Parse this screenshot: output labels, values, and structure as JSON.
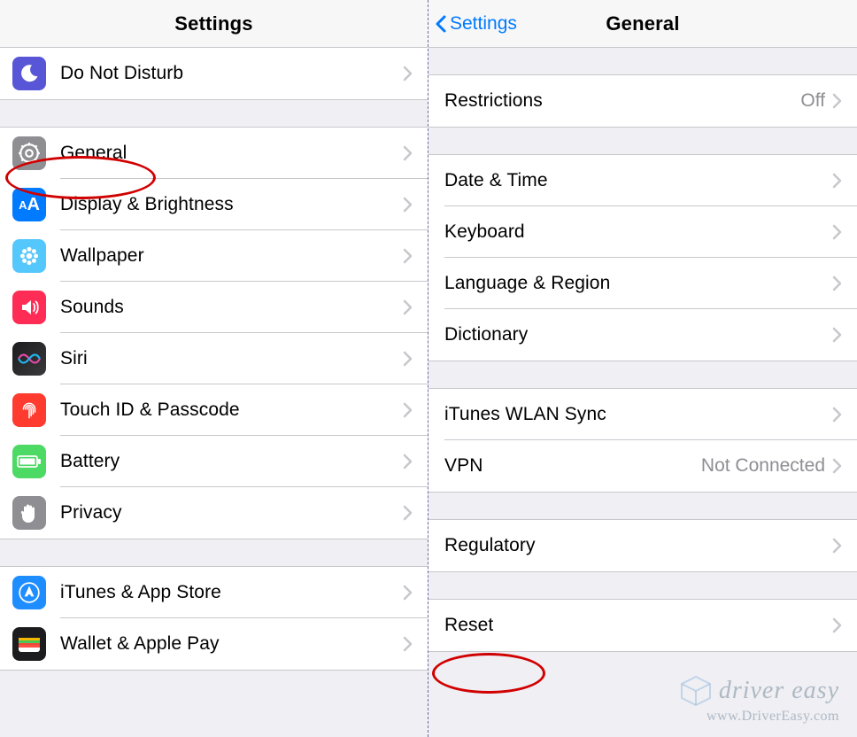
{
  "left": {
    "title": "Settings",
    "group1": [
      {
        "key": "dnd",
        "label": "Do Not Disturb"
      }
    ],
    "group2": [
      {
        "key": "general",
        "label": "General"
      },
      {
        "key": "display",
        "label": "Display & Brightness"
      },
      {
        "key": "wallpaper",
        "label": "Wallpaper"
      },
      {
        "key": "sounds",
        "label": "Sounds"
      },
      {
        "key": "siri",
        "label": "Siri"
      },
      {
        "key": "touchid",
        "label": "Touch ID & Passcode"
      },
      {
        "key": "battery",
        "label": "Battery"
      },
      {
        "key": "privacy",
        "label": "Privacy"
      }
    ],
    "group3": [
      {
        "key": "itunes",
        "label": "iTunes & App Store"
      },
      {
        "key": "wallet",
        "label": "Wallet & Apple Pay"
      }
    ]
  },
  "right": {
    "back": "Settings",
    "title": "General",
    "group1": [
      {
        "key": "restrictions",
        "label": "Restrictions",
        "value": "Off"
      }
    ],
    "group2": [
      {
        "key": "datetime",
        "label": "Date & Time"
      },
      {
        "key": "keyboard",
        "label": "Keyboard"
      },
      {
        "key": "langregion",
        "label": "Language & Region"
      },
      {
        "key": "dictionary",
        "label": "Dictionary"
      }
    ],
    "group3": [
      {
        "key": "ituneswlan",
        "label": "iTunes WLAN Sync"
      },
      {
        "key": "vpn",
        "label": "VPN",
        "value": "Not Connected"
      }
    ],
    "group4": [
      {
        "key": "regulatory",
        "label": "Regulatory"
      }
    ],
    "group5": [
      {
        "key": "reset",
        "label": "Reset"
      }
    ]
  },
  "watermark": {
    "brand": "driver easy",
    "url": "www.DriverEasy.com"
  }
}
